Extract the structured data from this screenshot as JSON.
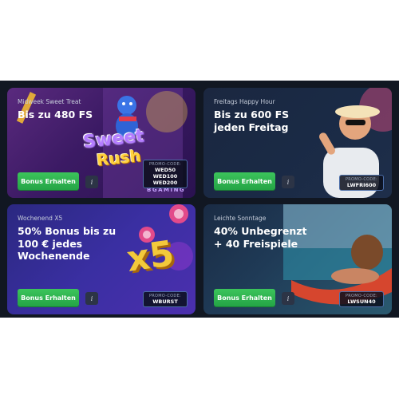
{
  "cards": [
    {
      "subtitle": "Midweek Sweet Treat",
      "title": "Bis zu 480 FS",
      "button": "Bonus Erhalten",
      "info": "i",
      "promo_label": "PROMO-CODE:",
      "promo_codes": [
        "WED50",
        "WED100",
        "WED200"
      ],
      "art_text": [
        "Sweet",
        "Rush",
        "BGAMING"
      ]
    },
    {
      "subtitle": "Freitags Happy Hour",
      "title": "Bis zu 600 FS jeden Freitag",
      "button": "Bonus Erhalten",
      "info": "i",
      "promo_label": "PROMO-CODE:",
      "promo_codes": [
        "LWFRI600"
      ]
    },
    {
      "subtitle": "Wochenend X5",
      "title": "50% Bonus bis zu 100 € jedes Wochenende",
      "button": "Bonus Erhalten",
      "info": "i",
      "promo_label": "PROMO-CODE:",
      "promo_codes": [
        "WBURST"
      ],
      "art_text": [
        "x5"
      ]
    },
    {
      "subtitle": "Leichte Sonntage",
      "title": "40% Unbegrenzt + 40 Freispiele",
      "button": "Bonus Erhalten",
      "info": "i",
      "promo_label": "PROMO-CODE:",
      "promo_codes": [
        "LWSUN40"
      ]
    }
  ],
  "colors": {
    "panel": "#111722",
    "button": "#2eb34f",
    "promo_border": "#4c6ea8"
  }
}
